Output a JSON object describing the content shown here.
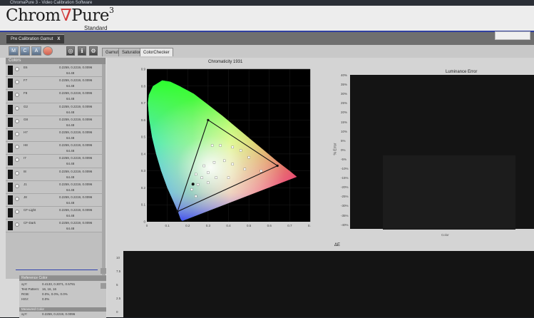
{
  "window": {
    "title": "ChromaPure 3 - Video Calibration Software"
  },
  "brand": {
    "name_a": "Chrom",
    "name_v": "∇",
    "name_b": "Pure",
    "sup": "3",
    "edition": "Standard"
  },
  "document_tab": {
    "label": "Pre Calibration Gamut",
    "close": "X"
  },
  "toolbar": {
    "buttons": [
      {
        "label": "M",
        "icon": "meter-button"
      },
      {
        "label": "C",
        "icon": "calibrate-button"
      },
      {
        "label": "A",
        "icon": "analyze-button"
      }
    ],
    "tools": [
      "◎",
      "ℹ",
      "⚙"
    ],
    "view_tabs": [
      "Gamut",
      "Saturations",
      "ColorChecker"
    ],
    "active_view": "ColorChecker"
  },
  "colors_panel": {
    "header": "Colors",
    "items": [
      {
        "name": "E6",
        "xy": "0.2259, 0.2219, 0.0096",
        "lum": "64.48"
      },
      {
        "name": "F7",
        "xy": "0.2259, 0.2219, 0.0096",
        "lum": "64.48"
      },
      {
        "name": "F8",
        "xy": "0.2259, 0.2219, 0.0096",
        "lum": "64.48"
      },
      {
        "name": "G2",
        "xy": "0.2259, 0.2219, 0.0096",
        "lum": "64.48"
      },
      {
        "name": "G8",
        "xy": "0.2259, 0.2219, 0.0096",
        "lum": "64.48"
      },
      {
        "name": "H7",
        "xy": "0.2259, 0.2219, 0.0096",
        "lum": "64.48"
      },
      {
        "name": "H8",
        "xy": "0.2259, 0.2219, 0.0096",
        "lum": "64.48"
      },
      {
        "name": "I7",
        "xy": "0.2259, 0.2219, 0.0096",
        "lum": "64.48"
      },
      {
        "name": "I8",
        "xy": "0.2259, 0.2219, 0.0096",
        "lum": "64.48"
      },
      {
        "name": "J1",
        "xy": "0.2259, 0.2219, 0.0096",
        "lum": "64.48"
      },
      {
        "name": "J8",
        "xy": "0.2259, 0.2219, 0.0096",
        "lum": "64.48"
      },
      {
        "name": "CF-Light",
        "xy": "0.2259, 0.2219, 0.0096",
        "lum": "64.48"
      },
      {
        "name": "CF-Dark",
        "xy": "0.2259, 0.2219, 0.0096",
        "lum": "64.48"
      }
    ]
  },
  "reference_color": {
    "header": "Reference Color",
    "rows": [
      {
        "label": "xyY:",
        "value": "0.4133, 0.3071, 0.5791"
      },
      {
        "label": "Test Pattern:",
        "value": "16, 16, 16"
      },
      {
        "label": "RGB:",
        "value": "0.0%, 0.0%, 0.0%"
      },
      {
        "label": "HSV:",
        "value": "0.0%"
      }
    ]
  },
  "measured_color": {
    "header": "Measured Color",
    "rows": [
      {
        "label": "xyY:",
        "value": "0.2259, 0.2219, 0.0096"
      }
    ]
  },
  "chromaticity_chart": {
    "title": "Chromaticity 1931",
    "x_ticks": [
      "0",
      "0.1",
      "0.2",
      "0.3",
      "0.4",
      "0.5",
      "0.6",
      "0.7",
      "0.8"
    ],
    "y_ticks": [
      "0",
      "0.1",
      "0.2",
      "0.3",
      "0.4",
      "0.5",
      "0.6",
      "0.7",
      "0.8",
      "0.9"
    ]
  },
  "luminance_chart": {
    "title": "Luminance Error",
    "y_label": "% Error",
    "x_label": "Color",
    "y_ticks": [
      "40%",
      "35%",
      "30%",
      "25%",
      "20%",
      "15%",
      "10%",
      "5%",
      "0%",
      "-5%",
      "-10%",
      "-15%",
      "-20%",
      "-25%",
      "-30%",
      "-35%",
      "-40%"
    ]
  },
  "delta_e_chart": {
    "title": "ΔE",
    "y_ticks": [
      "10",
      "7.5",
      "5",
      "2.5",
      "0"
    ]
  },
  "chart_data": [
    {
      "type": "scatter",
      "title": "Chromaticity 1931",
      "xlim": [
        0,
        0.8
      ],
      "ylim": [
        0,
        0.9
      ],
      "gamut_triangle": [
        [
          0.64,
          0.33
        ],
        [
          0.3,
          0.6
        ],
        [
          0.15,
          0.06
        ]
      ],
      "white_point": [
        0.3127,
        0.329
      ],
      "series": [
        {
          "values": [
            [
              0.32,
              0.45
            ],
            [
              0.36,
              0.45
            ],
            [
              0.42,
              0.44
            ],
            [
              0.46,
              0.42
            ],
            [
              0.5,
              0.38
            ],
            [
              0.28,
              0.33
            ],
            [
              0.33,
              0.35
            ],
            [
              0.38,
              0.36
            ],
            [
              0.42,
              0.34
            ],
            [
              0.48,
              0.31
            ],
            [
              0.56,
              0.3
            ],
            [
              0.24,
              0.28
            ],
            [
              0.3,
              0.29
            ],
            [
              0.27,
              0.26
            ],
            [
              0.34,
              0.26
            ],
            [
              0.4,
              0.26
            ],
            [
              0.25,
              0.22
            ],
            [
              0.3,
              0.23
            ],
            [
              0.22,
              0.19
            ],
            [
              0.24,
              0.15
            ]
          ]
        },
        {
          "name": "Measured",
          "values": [
            [
              0.226,
              0.222
            ]
          ]
        }
      ]
    },
    {
      "type": "bar",
      "title": "Luminance Error",
      "xlabel": "Color",
      "ylabel": "% Error",
      "ylim": [
        -40,
        40
      ],
      "categories": [],
      "values": []
    },
    {
      "type": "bar",
      "title": "ΔE",
      "ylim": [
        0,
        10
      ],
      "categories": [],
      "values": []
    }
  ]
}
